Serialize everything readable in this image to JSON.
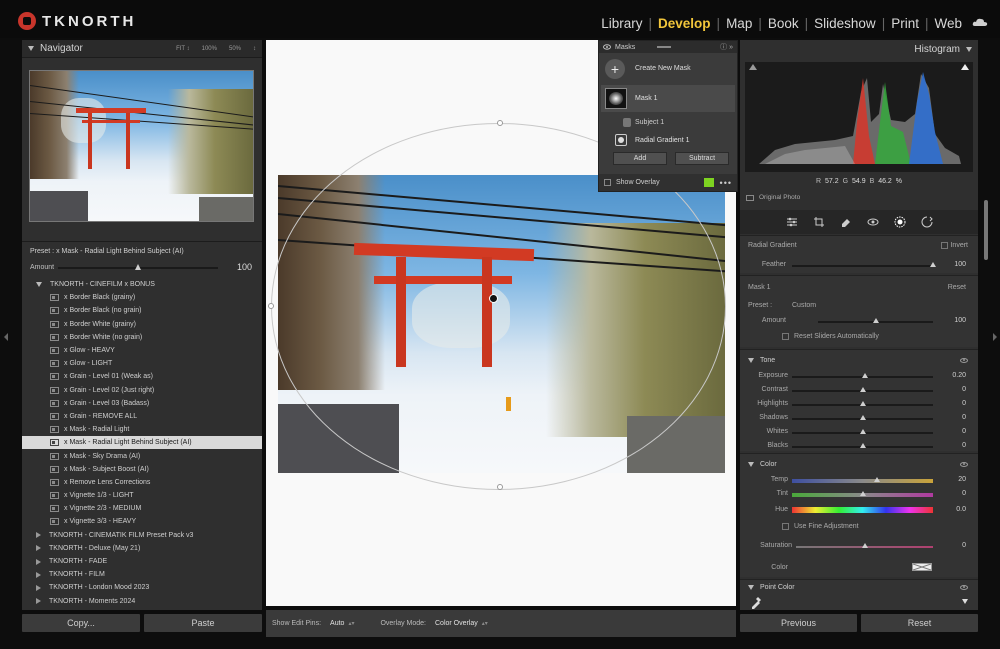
{
  "app": {
    "brand": "TKNORTH"
  },
  "modules": [
    "Library",
    "Develop",
    "Map",
    "Book",
    "Slideshow",
    "Print",
    "Web"
  ],
  "active_module": "Develop",
  "navigator": {
    "title": "Navigator",
    "zoom": [
      "FIT ↕",
      "100%",
      "50%",
      "↕"
    ]
  },
  "preset_panel": {
    "preset_label": "Preset : x Mask - Radial Light Behind Subject (AI)",
    "amount_label": "Amount",
    "amount_value": "100",
    "amount_level": 0.5
  },
  "preset_groups": [
    {
      "name": "TKNORTH - CINEFILM x BONUS",
      "expanded": true,
      "items": [
        "x Border Black (grainy)",
        "x Border Black (no grain)",
        "x Border White (grainy)",
        "x Border White (no grain)",
        "x Glow - HEAVY",
        "x Glow - LIGHT",
        "x Grain - Level 01 (Weak as)",
        "x Grain - Level 02 (Just right)",
        "x Grain - Level 03 (Badass)",
        "x Grain - REMOVE ALL",
        "x Mask - Radial Light",
        "x Mask - Radial Light Behind Subject (AI)",
        "x Mask - Sky Drama (AI)",
        "x Mask - Subject Boost (AI)",
        "x Remove Lens Corrections",
        "x Vignette 1/3 - LIGHT",
        "x Vignette 2/3 - MEDIUM",
        "x Vignette 3/3 - HEAVY"
      ]
    },
    {
      "name": "TKNORTH - CINEMATIK FILM Preset Pack v3",
      "expanded": false
    },
    {
      "name": "TKNORTH - Deluxe (May 21)",
      "expanded": false
    },
    {
      "name": "TKNORTH - FADE",
      "expanded": false
    },
    {
      "name": "TKNORTH - FILM",
      "expanded": false
    },
    {
      "name": "TKNORTH - London Mood 2023",
      "expanded": false
    },
    {
      "name": "TKNORTH - Moments 2024",
      "expanded": false
    }
  ],
  "selected_preset": "x Mask - Radial Light Behind Subject (AI)",
  "left_buttons": {
    "copy": "Copy...",
    "paste": "Paste"
  },
  "masks": {
    "title": "Masks",
    "help": "ⓘ »",
    "create": "Create New Mask",
    "mask_name": "Mask 1",
    "subject": "Subject 1",
    "radial": "Radial Gradient 1",
    "add": "Add",
    "subtract": "Subtract",
    "show_overlay": "Show Overlay",
    "overlay_color": "#7ed321",
    "more": "•••"
  },
  "toolbar": {
    "edit_pins_label": "Show Edit Pins:",
    "edit_pins_value": "Auto",
    "overlay_mode_label": "Overlay Mode:",
    "overlay_mode_value": "Color Overlay"
  },
  "histogram": {
    "title": "Histogram",
    "r_label": "R",
    "r_value": "57.2",
    "g_label": "G",
    "g_value": "54.9",
    "b_label": "B",
    "b_value": "46.2 %",
    "original_photo": "Original Photo"
  },
  "develop": {
    "radial_gradient": "Radial Gradient",
    "invert": "Invert",
    "feather_label": "Feather",
    "feather_value": "100",
    "feather_level": 1.0,
    "mask_label": "Mask 1",
    "reset": "Reset",
    "preset_label": "Preset :",
    "preset_value": "Custom",
    "amount_label": "Amount",
    "amount_value": "100",
    "amount_level": 0.5,
    "reset_sliders": "Reset Sliders Automatically",
    "tone": {
      "title": "Tone",
      "sliders": [
        {
          "label": "Exposure",
          "value": "0.20",
          "level": 0.52
        },
        {
          "label": "Contrast",
          "value": "0",
          "level": 0.5
        },
        {
          "label": "Highlights",
          "value": "0",
          "level": 0.5
        },
        {
          "label": "Shadows",
          "value": "0",
          "level": 0.5
        },
        {
          "label": "Whites",
          "value": "0",
          "level": 0.5
        },
        {
          "label": "Blacks",
          "value": "0",
          "level": 0.5
        }
      ]
    },
    "color": {
      "title": "Color",
      "temp_label": "Temp",
      "temp_value": "20",
      "temp_level": 0.6,
      "tint_label": "Tint",
      "tint_value": "0",
      "tint_level": 0.5,
      "hue_label": "Hue",
      "hue_value": "0.0",
      "fine_adjust": "Use Fine Adjustment",
      "saturation_label": "Saturation",
      "saturation_value": "0",
      "saturation_level": 0.5,
      "color_label": "Color"
    },
    "point_color": {
      "title": "Point Color"
    }
  },
  "right_buttons": {
    "previous": "Previous",
    "reset": "Reset"
  }
}
